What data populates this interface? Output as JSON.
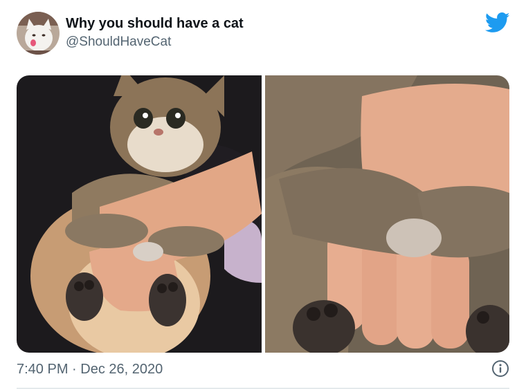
{
  "tweet": {
    "display_name": "Why you should have a cat",
    "handle": "@ShouldHaveCat",
    "time": "7:40 PM",
    "separator": "·",
    "date": "Dec 26, 2020"
  },
  "icons": {
    "brand": "twitter-bird-icon",
    "info": "info-icon"
  },
  "colors": {
    "brand_blue": "#1d9bf0",
    "text_primary": "#0f1419",
    "text_secondary": "#536471",
    "divider": "#cfd9de"
  }
}
